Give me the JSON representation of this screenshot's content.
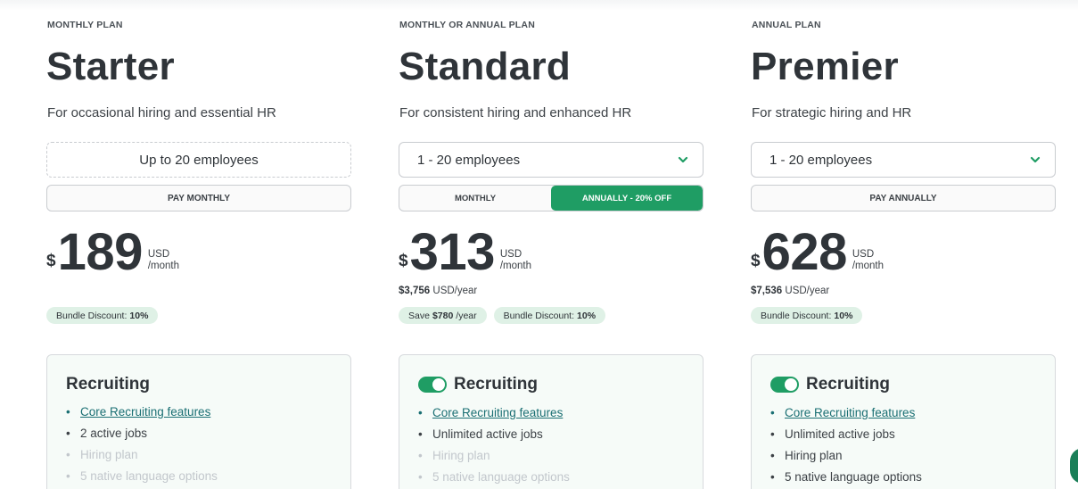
{
  "plans": [
    {
      "eyebrow": "MONTHLY PLAN",
      "name": "Starter",
      "tagline": "For occasional hiring and essential HR",
      "employees": "Up to 20 employees",
      "pay_label": "PAY MONTHLY",
      "currency": "$",
      "price": "189",
      "price_unit_top": "USD",
      "price_unit_bottom": "/month",
      "bundle_label": "Bundle Discount:",
      "bundle_value": "10%",
      "features": {
        "title": "Recruiting",
        "items": [
          {
            "text": "Core Recruiting features"
          },
          {
            "text": "2 active jobs"
          },
          {
            "text": "Hiring plan"
          },
          {
            "text": "5 native language options"
          }
        ]
      }
    },
    {
      "eyebrow": "MONTHLY OR ANNUAL PLAN",
      "name": "Standard",
      "tagline": "For consistent hiring and enhanced HR",
      "employees": "1 - 20 employees",
      "toggle_monthly": "MONTHLY",
      "toggle_annual": "ANNUALLY - 20% OFF",
      "currency": "$",
      "price": "313",
      "price_unit_top": "USD",
      "price_unit_bottom": "/month",
      "yearly_amount": "$3,756",
      "yearly_unit": "USD/year",
      "save_label": "Save",
      "save_value": "$780",
      "save_unit": "/year",
      "bundle_label": "Bundle Discount:",
      "bundle_value": "10%",
      "features": {
        "title": "Recruiting",
        "items": [
          {
            "text": "Core Recruiting features"
          },
          {
            "text": "Unlimited active jobs"
          },
          {
            "text": "Hiring plan"
          },
          {
            "text": "5 native language options"
          }
        ]
      }
    },
    {
      "eyebrow": "ANNUAL PLAN",
      "name": "Premier",
      "tagline": "For strategic hiring and HR",
      "employees": "1 - 20 employees",
      "pay_label": "PAY ANNUALLY",
      "currency": "$",
      "price": "628",
      "price_unit_top": "USD",
      "price_unit_bottom": "/month",
      "yearly_amount": "$7,536",
      "yearly_unit": "USD/year",
      "bundle_label": "Bundle Discount:",
      "bundle_value": "10%",
      "features": {
        "title": "Recruiting",
        "items": [
          {
            "text": "Core Recruiting features"
          },
          {
            "text": "Unlimited active jobs"
          },
          {
            "text": "Hiring plan"
          },
          {
            "text": "5 native language options"
          }
        ]
      }
    }
  ],
  "colors": {
    "accent": "#1f9d64",
    "badge_bg": "#dff1e6",
    "link": "#1a6f73"
  }
}
